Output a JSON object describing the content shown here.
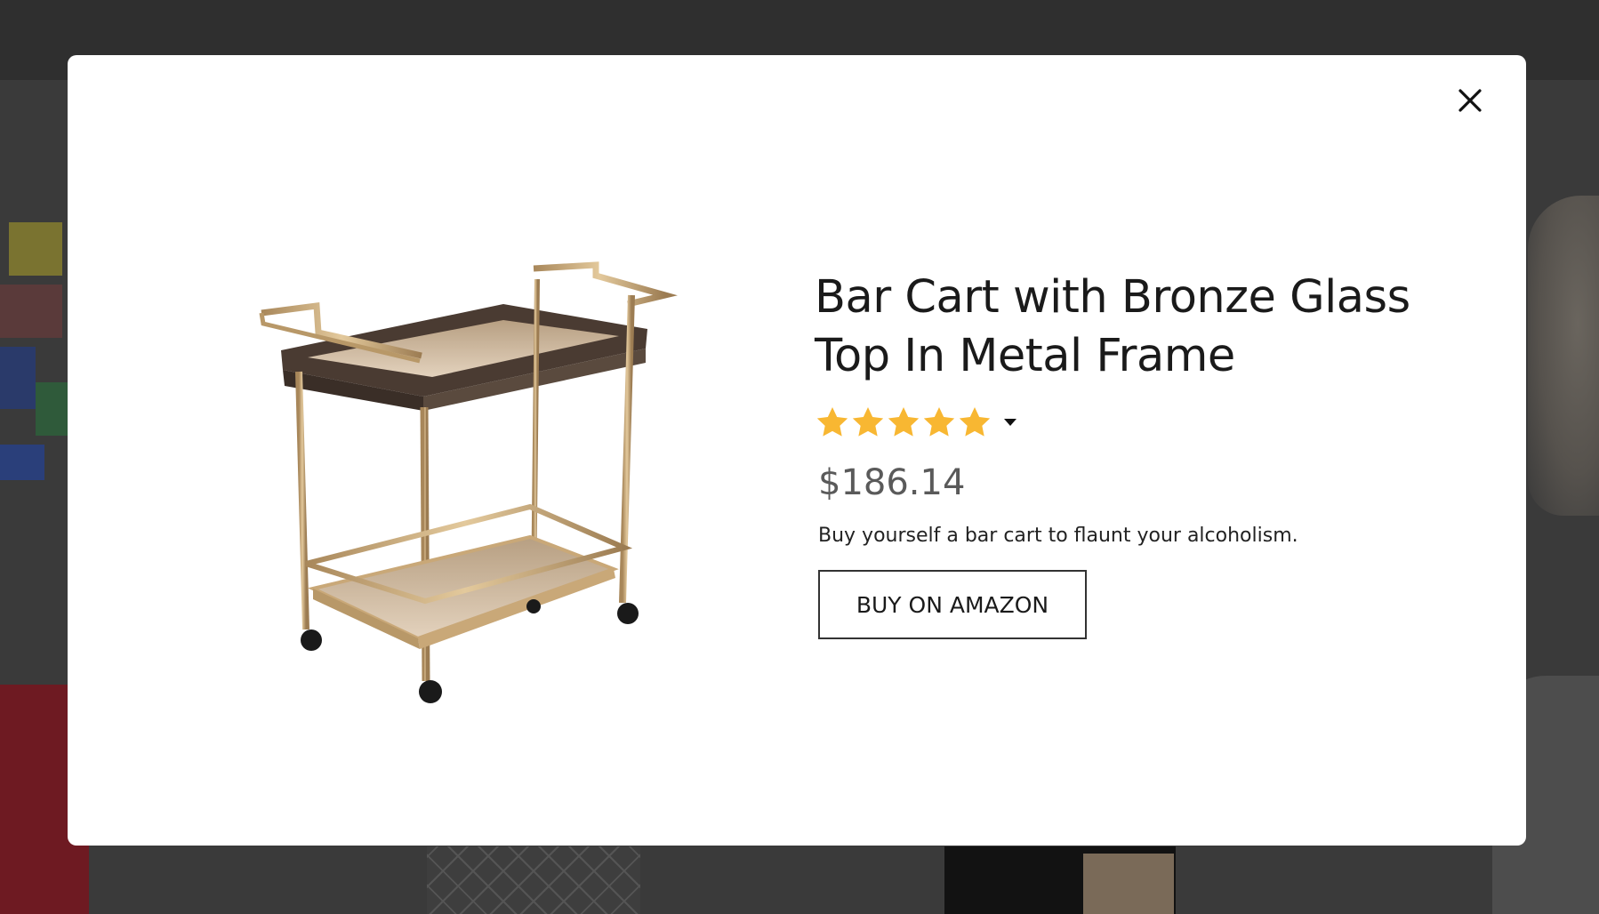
{
  "product": {
    "title": "Bar Cart with Bronze Glass Top In Metal Frame",
    "rating_stars": 5,
    "price": "$186.14",
    "description": "Buy yourself a bar cart to flaunt your alcoholism.",
    "buy_label": "BUY ON AMAZON",
    "image_name": "bar-cart-image"
  },
  "icons": {
    "close": "close-icon",
    "star": "star-icon",
    "caret": "caret-down-icon"
  },
  "colors": {
    "overlay": "#3a3a3a",
    "modal_bg": "#ffffff",
    "star": "#f8b732",
    "price": "#5a5a5a",
    "frame_gold": "#c9a878",
    "tray_dark": "#4a3b32"
  }
}
